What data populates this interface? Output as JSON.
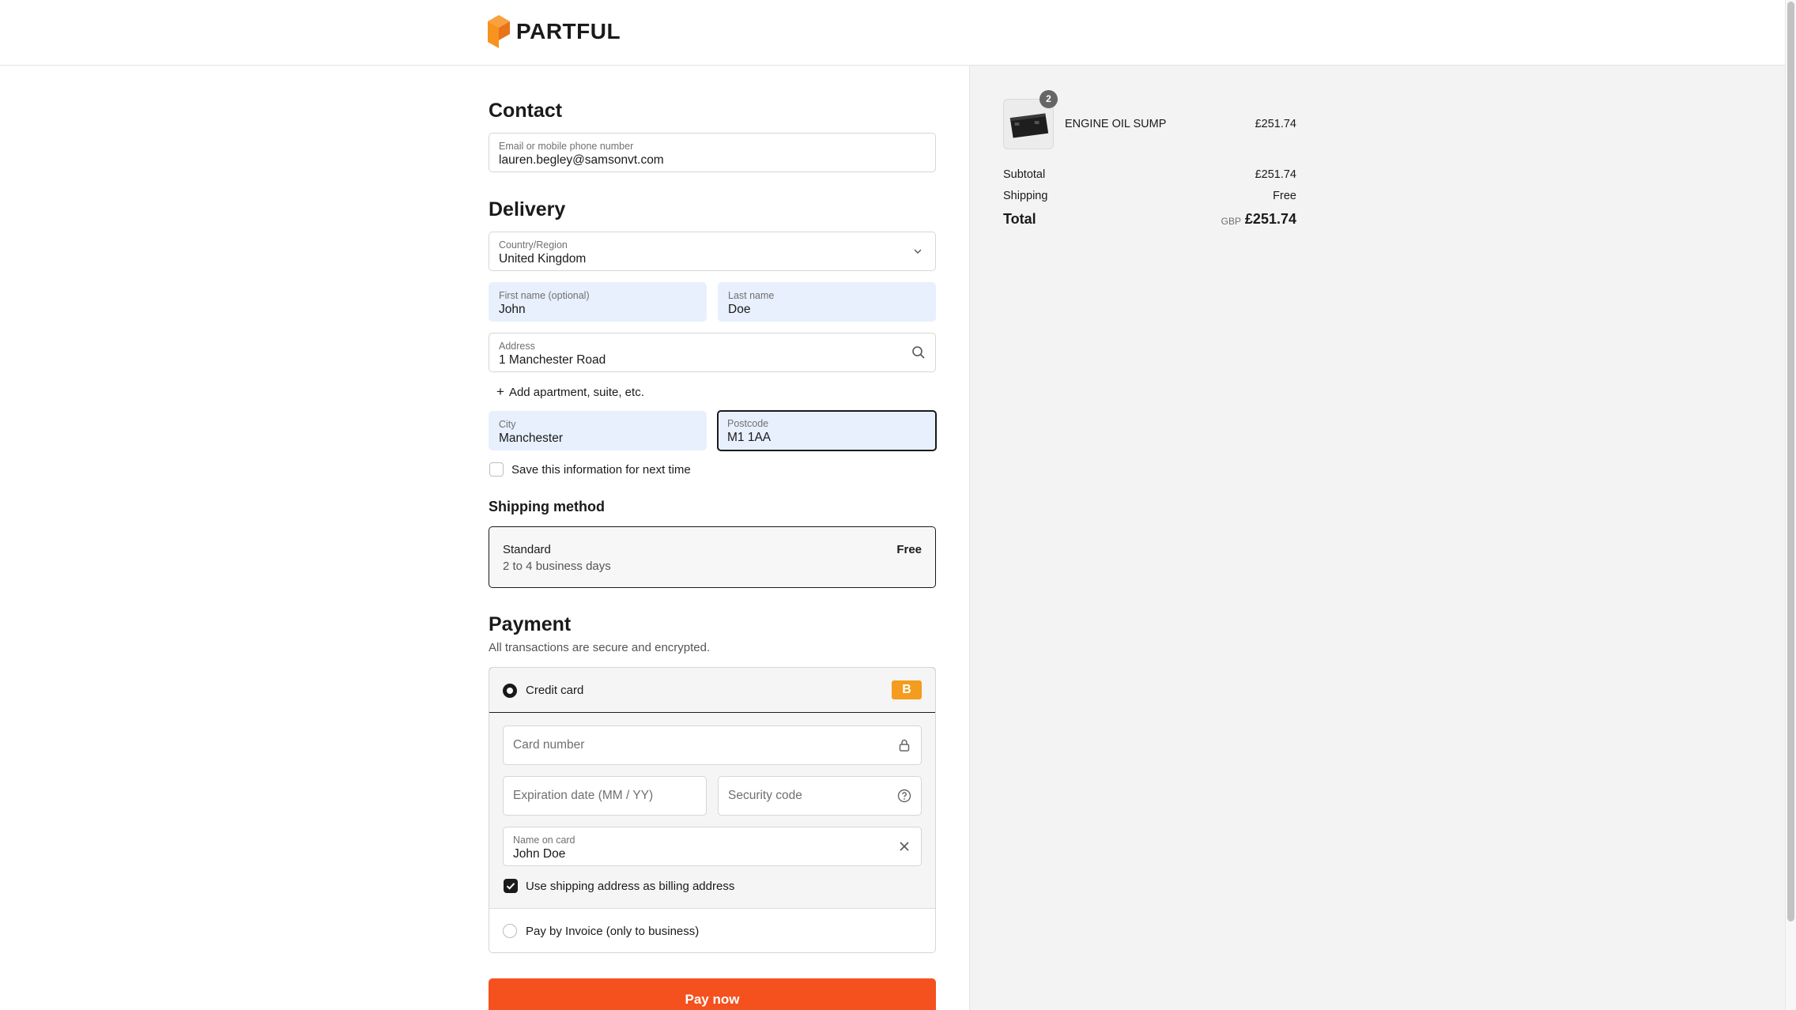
{
  "brand": {
    "name": "PARTFUL",
    "accent": "#f4511e",
    "logo_color": "#f7931e"
  },
  "contact": {
    "title": "Contact",
    "email_label": "Email or mobile phone number",
    "email_value": "lauren.begley@samsonvt.com"
  },
  "delivery": {
    "title": "Delivery",
    "country_label": "Country/Region",
    "country_value": "United Kingdom",
    "first_name_label": "First name (optional)",
    "first_name_value": "John",
    "last_name_label": "Last name",
    "last_name_value": "Doe",
    "address_label": "Address",
    "address_value": "1 Manchester Road",
    "add_apartment": "Add apartment, suite, etc.",
    "city_label": "City",
    "city_value": "Manchester",
    "postcode_label": "Postcode",
    "postcode_value": "M1 1AA",
    "save_info": "Save this information for next time"
  },
  "shipping_method": {
    "title": "Shipping method",
    "option_name": "Standard",
    "option_detail": "2 to 4 business days",
    "option_price": "Free"
  },
  "payment": {
    "title": "Payment",
    "subtitle": "All transactions are secure and encrypted.",
    "credit_card_label": "Credit card",
    "card_badge": "B",
    "card_number_placeholder": "Card number",
    "expiry_placeholder": "Expiration date (MM / YY)",
    "security_placeholder": "Security code",
    "name_on_card_label": "Name on card",
    "name_on_card_value": "John Doe",
    "billing_same": "Use shipping address as billing address",
    "invoice_label": "Pay by Invoice (only to business)",
    "pay_button": "Pay now"
  },
  "summary": {
    "item_name": "ENGINE OIL SUMP",
    "item_qty": "2",
    "item_price": "£251.74",
    "subtotal_label": "Subtotal",
    "subtotal_value": "£251.74",
    "shipping_label": "Shipping",
    "shipping_value": "Free",
    "total_label": "Total",
    "total_currency": "GBP",
    "total_value": "£251.74"
  }
}
